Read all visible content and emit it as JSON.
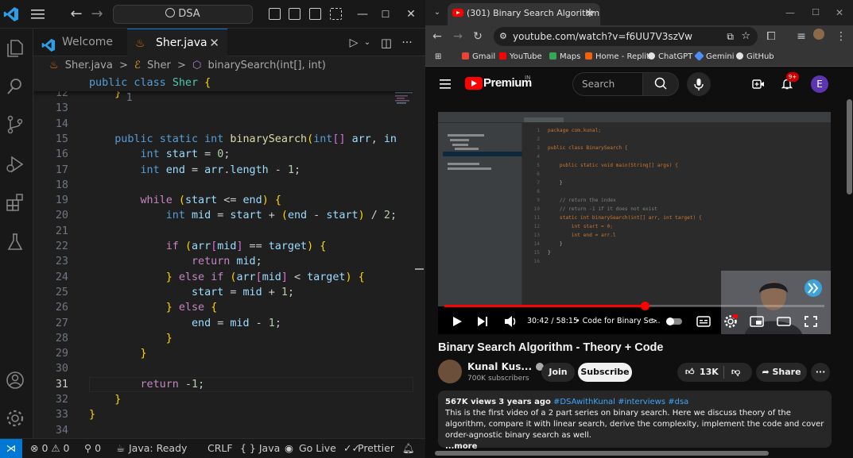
{
  "vscode": {
    "search_text": "DSA",
    "tabs": [
      {
        "label": "Welcome",
        "active": false
      },
      {
        "label": "Sher.java",
        "active": true,
        "close": "✕"
      }
    ],
    "breadcrumb": [
      "Sher.java",
      "Sher",
      "binarySearch(int[], int)"
    ],
    "breadcrumb_sep": ">",
    "sticky_line": {
      "num": "1",
      "text": "public class Sher {"
    },
    "current_line": "31",
    "lines": [
      {
        "num": "12",
        "text": "    }"
      },
      {
        "num": "13",
        "text": ""
      },
      {
        "num": "14",
        "text": ""
      },
      {
        "num": "15",
        "text": "    public static int binarySearch(int[] arr, in"
      },
      {
        "num": "16",
        "text": "        int start = 0;"
      },
      {
        "num": "17",
        "text": "        int end = arr.length - 1;"
      },
      {
        "num": "18",
        "text": ""
      },
      {
        "num": "19",
        "text": "        while (start <= end) {"
      },
      {
        "num": "20",
        "text": "            int mid = start + (end - start) / 2;"
      },
      {
        "num": "21",
        "text": ""
      },
      {
        "num": "22",
        "text": "            if (arr[mid] == target) {"
      },
      {
        "num": "23",
        "text": "                return mid;"
      },
      {
        "num": "24",
        "text": "            } else if (arr[mid] < target) {"
      },
      {
        "num": "25",
        "text": "                start = mid + 1;"
      },
      {
        "num": "26",
        "text": "            } else {"
      },
      {
        "num": "27",
        "text": "                end = mid - 1;"
      },
      {
        "num": "28",
        "text": "            }"
      },
      {
        "num": "29",
        "text": "        }"
      },
      {
        "num": "30",
        "text": ""
      },
      {
        "num": "31",
        "text": "        return -1;"
      },
      {
        "num": "32",
        "text": "    }"
      },
      {
        "num": "33",
        "text": "}"
      },
      {
        "num": "34",
        "text": ""
      }
    ],
    "status": {
      "problems": "⊗ 0 ⚠ 0",
      "ports": "⚲ 0",
      "java": "Java: Ready",
      "eol": "CRLF",
      "lang": "{ } Java",
      "live": "Go Live",
      "prettier": "Prettier"
    },
    "colors": {
      "accent": "#0078d4",
      "keyword": "#569cd6",
      "type": "#4ec9b0",
      "function": "#dcdcaa",
      "variable": "#9cdcfe",
      "number": "#b5cea8",
      "control": "#c586c0"
    }
  },
  "chrome": {
    "tab_title": "(301) Binary Search Algorithm",
    "tab_close": "✕",
    "new_tab": "+",
    "url": "youtube.com/watch?v=f6UU7V3szVw",
    "bookmarks": [
      "Gmail",
      "YouTube",
      "Maps",
      "Home - Replit",
      "ChatGPT",
      "Gemini",
      "GitHub"
    ]
  },
  "youtube": {
    "brand": "Premium",
    "region": "IN",
    "search_placeholder": "Search",
    "notifications": "9+",
    "avatar_letter": "E",
    "video": {
      "time": "30:42 / 58:15",
      "chapter": "• Code for Binary Se...",
      "chapter_arrow": ">",
      "progress_fraction": 0.527,
      "ide_lines": [
        {
          "n": "1",
          "t": "package com.kunal;"
        },
        {
          "n": "2",
          "t": ""
        },
        {
          "n": "3",
          "t": "public class BinarySearch {"
        },
        {
          "n": "4",
          "t": ""
        },
        {
          "n": "5",
          "t": "    public static void main(String[] args) {"
        },
        {
          "n": "6",
          "t": ""
        },
        {
          "n": "7",
          "t": "    }"
        },
        {
          "n": "8",
          "t": ""
        },
        {
          "n": "9",
          "t": "    // return the index"
        },
        {
          "n": "10",
          "t": "    // return -1 if it does not exist"
        },
        {
          "n": "11",
          "t": "    static int binarySearch(int[] arr, int target) {"
        },
        {
          "n": "12",
          "t": "        int start = 0;"
        },
        {
          "n": "13",
          "t": "        int end = arr.l"
        },
        {
          "n": "14",
          "t": "    }"
        },
        {
          "n": "15",
          "t": "}"
        },
        {
          "n": "16",
          "t": ""
        }
      ]
    },
    "title": "Binary Search Algorithm - Theory + Code",
    "channel": "Kunal Kus...",
    "subscribers": "700K subscribers",
    "join": "Join",
    "subscribe": "Subscribe",
    "likes": "13K",
    "share": "Share",
    "more": "···",
    "views": "567K views",
    "age": "3 years ago",
    "tags": "#DSAwithKunal #interviews #dsa",
    "description": "This is the first video of a 2 part series on binary search. Here we discuss theory of the algorithm, compare it with linear search, derive the complexity, implement the code and cover order-agnostic binary search as well.",
    "more_link": "...more",
    "colors": {
      "brand_red": "#ff0000",
      "link": "#3ea6ff"
    }
  }
}
